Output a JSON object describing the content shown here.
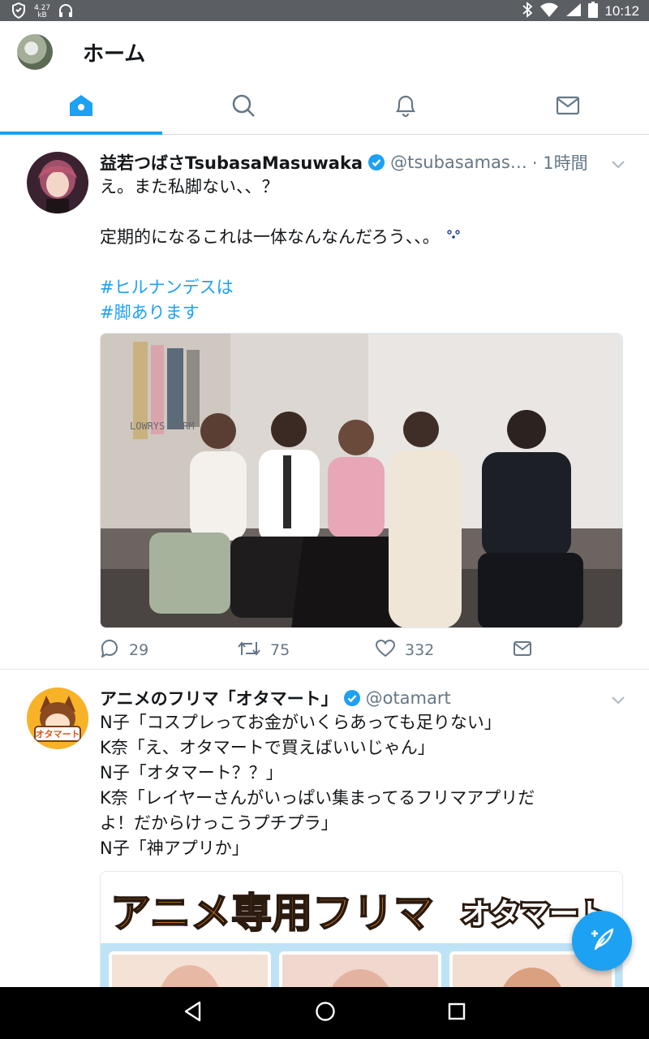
{
  "status_bar": {
    "net_speed_value": "4.27",
    "net_speed_unit": "kB",
    "time": "10:12"
  },
  "header": {
    "title": "ホーム"
  },
  "tabs": [
    {
      "name": "home-icon",
      "active": true
    },
    {
      "name": "search-icon",
      "active": false
    },
    {
      "name": "bell-icon",
      "active": false
    },
    {
      "name": "mail-icon",
      "active": false
    }
  ],
  "tweets": [
    {
      "display_name": "益若つばさTsubasaMasuwaka",
      "handle": "@tsubasamas…",
      "time": "· 1時間",
      "lines": [
        "え。また私脚ない、、？",
        "",
        "定期的になるこれは一体なんなんだろう、、。"
      ],
      "hashtags": [
        "#ヒルナンデスは",
        "#脚あります"
      ],
      "image_sign": "LOWRYS FARM",
      "replies": "29",
      "retweets": "75",
      "likes": "332"
    },
    {
      "display_name": "アニメのフリマ「オタマート」",
      "handle": "@otamart",
      "lines": [
        "N子「コスプレってお金がいくらあっても足りない」",
        "K奈「え、オタマートで買えばいいじゃん」",
        "N子「オタマート？？」",
        "K奈「レイヤーさんがいっぱい集まってるフリマアプリだ",
        "よ！だからけっこうプチプラ」",
        "N子「神アプリか」"
      ],
      "banner_text_1": "アニメ専用フリマ",
      "banner_text_2": "オタマート",
      "avatar_text": "オタマート"
    }
  ],
  "colors": {
    "accent": "#1da1f2",
    "status_bar": "#5b5e63",
    "secondary_text": "#657786"
  }
}
